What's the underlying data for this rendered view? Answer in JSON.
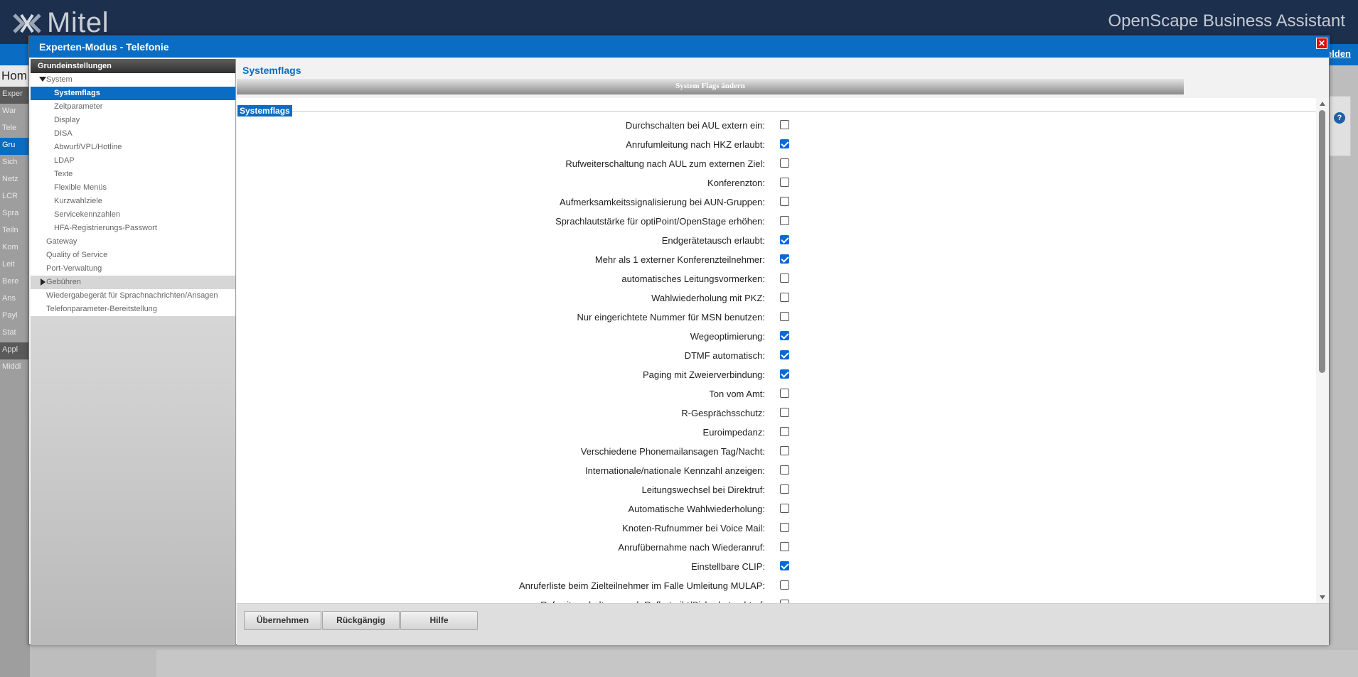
{
  "background": {
    "logo_text": "Mitel",
    "product_name": "OpenScape Business Assistant",
    "logout_fragment": "elden",
    "home_fragment": "Hom",
    "sidebar": [
      {
        "label": "Exper",
        "style": "dark"
      },
      {
        "label": "War",
        "style": "arrow"
      },
      {
        "label": "Tele",
        "style": "arrow-down"
      },
      {
        "label": "Gru",
        "style": "blue"
      },
      {
        "label": "Sich",
        "style": "plain"
      },
      {
        "label": "Netz",
        "style": "plain"
      },
      {
        "label": "LCR",
        "style": "plain"
      },
      {
        "label": "Spra",
        "style": "plain"
      },
      {
        "label": "Teiln",
        "style": "plain"
      },
      {
        "label": "Kom",
        "style": "plain"
      },
      {
        "label": "Leit",
        "style": "plain"
      },
      {
        "label": "Bere",
        "style": "plain"
      },
      {
        "label": "Ans",
        "style": "plain"
      },
      {
        "label": "Payl",
        "style": "plain"
      },
      {
        "label": "Stat",
        "style": "plain"
      },
      {
        "label": "Appl",
        "style": "dark"
      },
      {
        "label": "Middl",
        "style": "plain"
      }
    ]
  },
  "dialog": {
    "title": "Experten-Modus - Telefonie",
    "close_label": "✕"
  },
  "tree": {
    "header": "Grundeinstellungen",
    "items": [
      {
        "label": "System",
        "level": 1,
        "toggle": "down"
      },
      {
        "label": "Systemflags",
        "level": 2,
        "selected": true
      },
      {
        "label": "Zeitparameter",
        "level": 2
      },
      {
        "label": "Display",
        "level": 2
      },
      {
        "label": "DISA",
        "level": 2
      },
      {
        "label": "Abwurf/VPL/Hotline",
        "level": 2
      },
      {
        "label": "LDAP",
        "level": 2
      },
      {
        "label": "Texte",
        "level": 2
      },
      {
        "label": "Flexible Menüs",
        "level": 2
      },
      {
        "label": "Kurzwahlziele",
        "level": 2
      },
      {
        "label": "Servicekennzahlen",
        "level": 2
      },
      {
        "label": "HFA-Registrierungs-Passwort",
        "level": 2
      },
      {
        "label": "Gateway",
        "level": 1
      },
      {
        "label": "Quality of Service",
        "level": 1
      },
      {
        "label": "Port-Verwaltung",
        "level": 1
      },
      {
        "label": "Gebühren",
        "level": 1,
        "toggle": "right",
        "grey": true
      },
      {
        "label": "Wiedergabegerät für Sprachnachrichten/Ansagen",
        "level": 1
      },
      {
        "label": "Telefonparameter-Bereitstellung",
        "level": 1
      }
    ]
  },
  "content": {
    "title": "Systemflags",
    "section_header": "System Flags ändern",
    "legend": "Systemflags",
    "flags": [
      {
        "label": "Durchschalten bei AUL extern ein:",
        "checked": false
      },
      {
        "label": "Anrufumleitung nach HKZ erlaubt:",
        "checked": true
      },
      {
        "label": "Rufweiterschaltung nach AUL zum externen Ziel:",
        "checked": false
      },
      {
        "label": "Konferenzton:",
        "checked": false
      },
      {
        "label": "Aufmerksamkeitssignalisierung bei AUN-Gruppen:",
        "checked": false
      },
      {
        "label": "Sprachlautstärke für optiPoint/OpenStage erhöhen:",
        "checked": false
      },
      {
        "label": "Endgerätetausch erlaubt:",
        "checked": true
      },
      {
        "label": "Mehr als 1 externer Konferenzteilnehmer:",
        "checked": true
      },
      {
        "label": "automatisches Leitungsvormerken:",
        "checked": false
      },
      {
        "label": "Wahlwiederholung mit PKZ:",
        "checked": false
      },
      {
        "label": "Nur eingerichtete Nummer für MSN benutzen:",
        "checked": false
      },
      {
        "label": "Wegeoptimierung:",
        "checked": true
      },
      {
        "label": "DTMF automatisch:",
        "checked": true
      },
      {
        "label": "Paging mit Zweierverbindung:",
        "checked": true
      },
      {
        "label": "Ton vom Amt:",
        "checked": false
      },
      {
        "label": "R-Gesprächsschutz:",
        "checked": false
      },
      {
        "label": "Euroimpedanz:",
        "checked": false
      },
      {
        "label": "Verschiedene Phonemailansagen Tag/Nacht:",
        "checked": false
      },
      {
        "label": "Internationale/nationale Kennzahl anzeigen:",
        "checked": false
      },
      {
        "label": "Leitungswechsel bei Direktruf:",
        "checked": false
      },
      {
        "label": "Automatische Wahlwiederholung:",
        "checked": false
      },
      {
        "label": "Knoten-Rufnummer bei Voice Mail:",
        "checked": false
      },
      {
        "label": "Anrufübernahme nach Wiederanruf:",
        "checked": false
      },
      {
        "label": "Einstellbare CLIP:",
        "checked": true
      },
      {
        "label": "Anruferliste beim Zielteilnehmer im Falle Umleitung MULAP:",
        "checked": false
      },
      {
        "label": "Rufweiterschaltung nach Rufbetreibt/Sicherbetrachtruf:",
        "checked": false
      }
    ],
    "buttons": {
      "apply": "Übernehmen",
      "undo": "Rückgängig",
      "help": "Hilfe"
    }
  },
  "colors": {
    "accent": "#0a6cc2",
    "header_bg": "#1c2f4d",
    "close": "#d90f0f",
    "checkbox_checked": "#0b68d6"
  }
}
